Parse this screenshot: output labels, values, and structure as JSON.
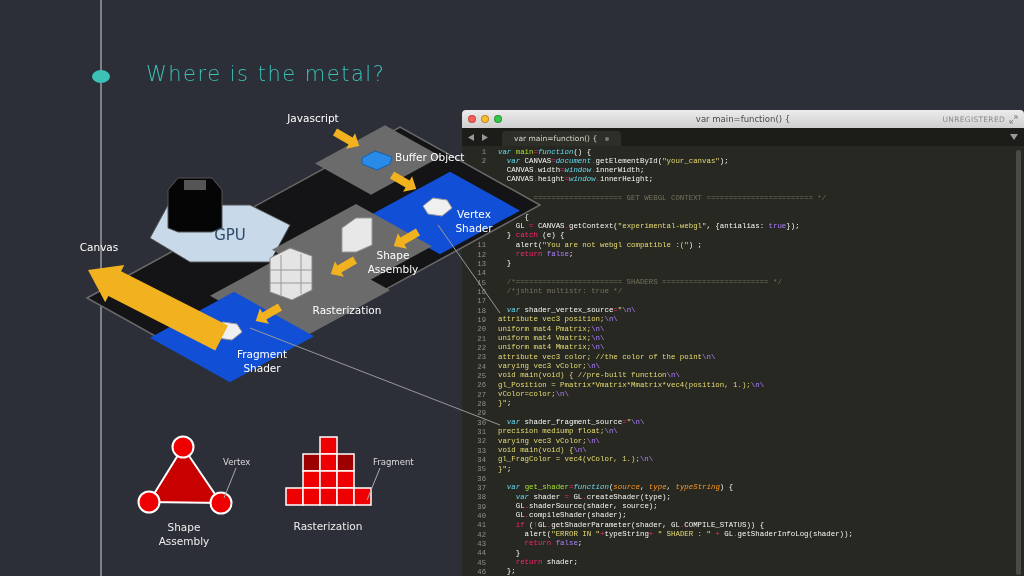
{
  "slide": {
    "title": "Where is the metal?"
  },
  "diagram": {
    "labels": [
      {
        "kind": "input",
        "lines": [
          "Javascript"
        ]
      },
      {
        "kind": "buffer",
        "lines": [
          "Buffer Object"
        ]
      },
      {
        "kind": "vertex",
        "lines": [
          "Vertex",
          "Shader"
        ]
      },
      {
        "kind": "shape",
        "lines": [
          "Shape",
          "Assembly"
        ]
      },
      {
        "kind": "raster",
        "lines": [
          "Rasterization"
        ]
      },
      {
        "kind": "fragment",
        "lines": [
          "Fragment",
          "Shader"
        ]
      },
      {
        "kind": "gpu",
        "lines": [
          "GPU"
        ]
      },
      {
        "kind": "canvas",
        "lines": [
          "Canvas"
        ]
      }
    ]
  },
  "legend": [
    {
      "kind": "triangle",
      "pointer": "Vertex",
      "caption": [
        "Shape",
        "Assembly"
      ]
    },
    {
      "kind": "grid",
      "pointer": "Fragment",
      "caption": [
        "Rasterization"
      ]
    }
  ],
  "editor": {
    "title": "var main=function() {",
    "license": "UNREGISTERED",
    "tab": "var main=function() {",
    "lines": [
      {
        "kind": "code",
        "number": "1",
        "code": [
          {
            "kind": "keyword",
            "text": "var "
          },
          {
            "kind": "function",
            "text": "main"
          },
          {
            "kind": "operator",
            "text": "="
          },
          {
            "kind": "keyword",
            "text": "function"
          },
          {
            "kind": "plain",
            "text": "() {"
          }
        ]
      },
      {
        "kind": "code",
        "number": "2",
        "code": [
          {
            "kind": "keyword",
            "text": "  var"
          },
          {
            "kind": "plain",
            "text": " CANVAS"
          },
          {
            "kind": "operator",
            "text": "="
          },
          {
            "kind": "keyword",
            "text": "document"
          },
          {
            "kind": "operator",
            "text": "."
          },
          {
            "kind": "plain",
            "text": "getElementById("
          },
          {
            "kind": "string",
            "text": "\"your_canvas\""
          },
          {
            "kind": "plain",
            "text": ");"
          }
        ]
      },
      {
        "kind": "code",
        "code": [
          {
            "kind": "plain",
            "text": "  CANVAS"
          },
          {
            "kind": "operator",
            "text": "."
          },
          {
            "kind": "plain",
            "text": "width"
          },
          {
            "kind": "operator",
            "text": "="
          },
          {
            "kind": "keyword",
            "text": "window"
          },
          {
            "kind": "operator",
            "text": "."
          },
          {
            "kind": "plain",
            "text": "innerWidth;"
          }
        ]
      },
      {
        "kind": "code",
        "code": [
          {
            "kind": "plain",
            "text": "  CANVAS"
          },
          {
            "kind": "operator",
            "text": "."
          },
          {
            "kind": "plain",
            "text": "height"
          },
          {
            "kind": "operator",
            "text": "="
          },
          {
            "kind": "keyword",
            "text": "window"
          },
          {
            "kind": "operator",
            "text": "."
          },
          {
            "kind": "plain",
            "text": "innerHeight;"
          }
        ]
      },
      {
        "kind": "blank"
      },
      {
        "kind": "code",
        "code": [
          {
            "kind": "comment",
            "text": "        ==================== GET WEBGL CONTEXT ======================== */"
          }
        ]
      },
      {
        "kind": "blank"
      },
      {
        "kind": "code",
        "code": [
          {
            "kind": "plain",
            "text": "      {"
          }
        ]
      },
      {
        "kind": "code",
        "code": [
          {
            "kind": "plain",
            "text": "    GL "
          },
          {
            "kind": "operator",
            "text": "="
          },
          {
            "kind": "plain",
            "text": " CANVAS"
          },
          {
            "kind": "operator",
            "text": "."
          },
          {
            "kind": "plain",
            "text": "getContext("
          },
          {
            "kind": "string",
            "text": "\"experimental-webgl\""
          },
          {
            "kind": "plain",
            "text": ", {antialias: "
          },
          {
            "kind": "constant",
            "text": "true"
          },
          {
            "kind": "plain",
            "text": "});"
          }
        ]
      },
      {
        "kind": "code",
        "code": [
          {
            "kind": "plain",
            "text": "  } "
          },
          {
            "kind": "operator",
            "text": "catch"
          },
          {
            "kind": "plain",
            "text": " (e) {"
          }
        ]
      },
      {
        "kind": "code",
        "number": "11",
        "code": [
          {
            "kind": "plain",
            "text": "    alert("
          },
          {
            "kind": "string",
            "text": "\"You are not webgl compatible :(\""
          },
          {
            "kind": "plain",
            "text": ") ;"
          }
        ]
      },
      {
        "kind": "code",
        "number": "12",
        "code": [
          {
            "kind": "operator",
            "text": "    return "
          },
          {
            "kind": "constant",
            "text": "false"
          },
          {
            "kind": "plain",
            "text": ";"
          }
        ]
      },
      {
        "kind": "code",
        "number": "13",
        "code": [
          {
            "kind": "plain",
            "text": "  }"
          }
        ]
      },
      {
        "kind": "blank",
        "number": "14"
      },
      {
        "kind": "code",
        "number": "15",
        "code": [
          {
            "kind": "comment",
            "text": "  /*======================== SHADERS ======================== */"
          }
        ]
      },
      {
        "kind": "code",
        "number": "16",
        "code": [
          {
            "kind": "comment",
            "text": "  /*jshint multistr: true */"
          }
        ]
      },
      {
        "kind": "blank",
        "number": "17"
      },
      {
        "kind": "code",
        "number": "18",
        "code": [
          {
            "kind": "keyword",
            "text": "  var"
          },
          {
            "kind": "plain",
            "text": " shader_vertex_source"
          },
          {
            "kind": "operator",
            "text": "="
          },
          {
            "kind": "string",
            "text": "\""
          },
          {
            "kind": "constant",
            "text": "\\n\\"
          }
        ]
      },
      {
        "kind": "code",
        "number": "19",
        "code": [
          {
            "kind": "string",
            "text": "attribute vec3 position;"
          },
          {
            "kind": "constant",
            "text": "\\n\\"
          }
        ]
      },
      {
        "kind": "code",
        "number": "20",
        "code": [
          {
            "kind": "string",
            "text": "uniform mat4 Pmatrix;"
          },
          {
            "kind": "constant",
            "text": "\\n\\"
          }
        ]
      },
      {
        "kind": "code",
        "number": "21",
        "code": [
          {
            "kind": "string",
            "text": "uniform mat4 Vmatrix;"
          },
          {
            "kind": "constant",
            "text": "\\n\\"
          }
        ]
      },
      {
        "kind": "code",
        "number": "22",
        "code": [
          {
            "kind": "string",
            "text": "uniform mat4 Mmatrix;"
          },
          {
            "kind": "constant",
            "text": "\\n\\"
          }
        ]
      },
      {
        "kind": "code",
        "number": "23",
        "code": [
          {
            "kind": "string",
            "text": "attribute vec3 color; //the color of the point"
          },
          {
            "kind": "constant",
            "text": "\\n\\"
          }
        ]
      },
      {
        "kind": "code",
        "number": "24",
        "code": [
          {
            "kind": "string",
            "text": "varying vec3 vColor;"
          },
          {
            "kind": "constant",
            "text": "\\n\\"
          }
        ]
      },
      {
        "kind": "code",
        "number": "25",
        "code": [
          {
            "kind": "string",
            "text": "void main(void) { //pre-built function"
          },
          {
            "kind": "constant",
            "text": "\\n\\"
          }
        ]
      },
      {
        "kind": "code",
        "number": "26",
        "code": [
          {
            "kind": "string",
            "text": "gl_Position = Pmatrix*Vmatrix*Mmatrix*vec4(position, 1.);"
          },
          {
            "kind": "constant",
            "text": "\\n\\"
          }
        ]
      },
      {
        "kind": "code",
        "number": "27",
        "code": [
          {
            "kind": "string",
            "text": "vColor=color;"
          },
          {
            "kind": "constant",
            "text": "\\n\\"
          }
        ]
      },
      {
        "kind": "code",
        "number": "28",
        "code": [
          {
            "kind": "string",
            "text": "}\""
          },
          {
            "kind": "plain",
            "text": ";"
          }
        ]
      },
      {
        "kind": "blank",
        "number": "29"
      },
      {
        "kind": "code",
        "number": "30",
        "code": [
          {
            "kind": "keyword",
            "text": "  var"
          },
          {
            "kind": "plain",
            "text": " shader_fragment_source"
          },
          {
            "kind": "operator",
            "text": "="
          },
          {
            "kind": "string",
            "text": "\""
          },
          {
            "kind": "constant",
            "text": "\\n\\"
          }
        ]
      },
      {
        "kind": "code",
        "number": "31",
        "code": [
          {
            "kind": "string",
            "text": "precision mediump float;"
          },
          {
            "kind": "constant",
            "text": "\\n\\"
          }
        ]
      },
      {
        "kind": "code",
        "number": "32",
        "code": [
          {
            "kind": "string",
            "text": "varying vec3 vColor;"
          },
          {
            "kind": "constant",
            "text": "\\n\\"
          }
        ]
      },
      {
        "kind": "code",
        "number": "33",
        "code": [
          {
            "kind": "string",
            "text": "void main(void) {"
          },
          {
            "kind": "constant",
            "text": "\\n\\"
          }
        ]
      },
      {
        "kind": "code",
        "number": "34",
        "code": [
          {
            "kind": "string",
            "text": "gl_FragColor = vec4(vColor, 1.);"
          },
          {
            "kind": "constant",
            "text": "\\n\\"
          }
        ]
      },
      {
        "kind": "code",
        "number": "35",
        "code": [
          {
            "kind": "string",
            "text": "}\""
          },
          {
            "kind": "plain",
            "text": ";"
          }
        ]
      },
      {
        "kind": "blank",
        "number": "36"
      },
      {
        "kind": "code",
        "number": "37",
        "code": [
          {
            "kind": "keyword",
            "text": "  var "
          },
          {
            "kind": "function",
            "text": "get_shader"
          },
          {
            "kind": "operator",
            "text": "="
          },
          {
            "kind": "keyword",
            "text": "function"
          },
          {
            "kind": "plain",
            "text": "("
          },
          {
            "kind": "param",
            "text": "source"
          },
          {
            "kind": "plain",
            "text": ", "
          },
          {
            "kind": "param",
            "text": "type"
          },
          {
            "kind": "plain",
            "text": ", "
          },
          {
            "kind": "param",
            "text": "typeString"
          },
          {
            "kind": "plain",
            "text": ") {"
          }
        ]
      },
      {
        "kind": "code",
        "number": "38",
        "code": [
          {
            "kind": "keyword",
            "text": "    var"
          },
          {
            "kind": "plain",
            "text": " shader "
          },
          {
            "kind": "operator",
            "text": "="
          },
          {
            "kind": "plain",
            "text": " GL"
          },
          {
            "kind": "operator",
            "text": "."
          },
          {
            "kind": "plain",
            "text": "createShader(type);"
          }
        ]
      },
      {
        "kind": "code",
        "number": "39",
        "code": [
          {
            "kind": "plain",
            "text": "    GL"
          },
          {
            "kind": "operator",
            "text": "."
          },
          {
            "kind": "plain",
            "text": "shaderSource(shader, source);"
          }
        ]
      },
      {
        "kind": "code",
        "number": "40",
        "code": [
          {
            "kind": "plain",
            "text": "    GL"
          },
          {
            "kind": "operator",
            "text": "."
          },
          {
            "kind": "plain",
            "text": "compileShader(shader);"
          }
        ]
      },
      {
        "kind": "code",
        "number": "41",
        "code": [
          {
            "kind": "operator",
            "text": "    if"
          },
          {
            "kind": "plain",
            "text": " ("
          },
          {
            "kind": "operator",
            "text": "!"
          },
          {
            "kind": "plain",
            "text": "GL"
          },
          {
            "kind": "operator",
            "text": "."
          },
          {
            "kind": "plain",
            "text": "getShaderParameter(shader, GL"
          },
          {
            "kind": "operator",
            "text": "."
          },
          {
            "kind": "plain",
            "text": "COMPILE_STATUS)) {"
          }
        ]
      },
      {
        "kind": "code",
        "number": "42",
        "code": [
          {
            "kind": "plain",
            "text": "      alert("
          },
          {
            "kind": "string",
            "text": "\"ERROR IN \""
          },
          {
            "kind": "operator",
            "text": "+"
          },
          {
            "kind": "plain",
            "text": "typeString"
          },
          {
            "kind": "operator",
            "text": "+"
          },
          {
            "kind": "string",
            "text": " \" SHADER : \""
          },
          {
            "kind": "operator",
            "text": " +"
          },
          {
            "kind": "plain",
            "text": " GL"
          },
          {
            "kind": "operator",
            "text": "."
          },
          {
            "kind": "plain",
            "text": "getShaderInfoLog(shader));"
          }
        ]
      },
      {
        "kind": "code",
        "number": "43",
        "code": [
          {
            "kind": "operator",
            "text": "      return "
          },
          {
            "kind": "constant",
            "text": "false"
          },
          {
            "kind": "plain",
            "text": ";"
          }
        ]
      },
      {
        "kind": "code",
        "number": "44",
        "code": [
          {
            "kind": "plain",
            "text": "    }"
          }
        ]
      },
      {
        "kind": "code",
        "number": "45",
        "code": [
          {
            "kind": "operator",
            "text": "    return"
          },
          {
            "kind": "plain",
            "text": " shader;"
          }
        ]
      },
      {
        "kind": "code",
        "number": "46",
        "code": [
          {
            "kind": "plain",
            "text": "  };"
          }
        ]
      }
    ]
  }
}
